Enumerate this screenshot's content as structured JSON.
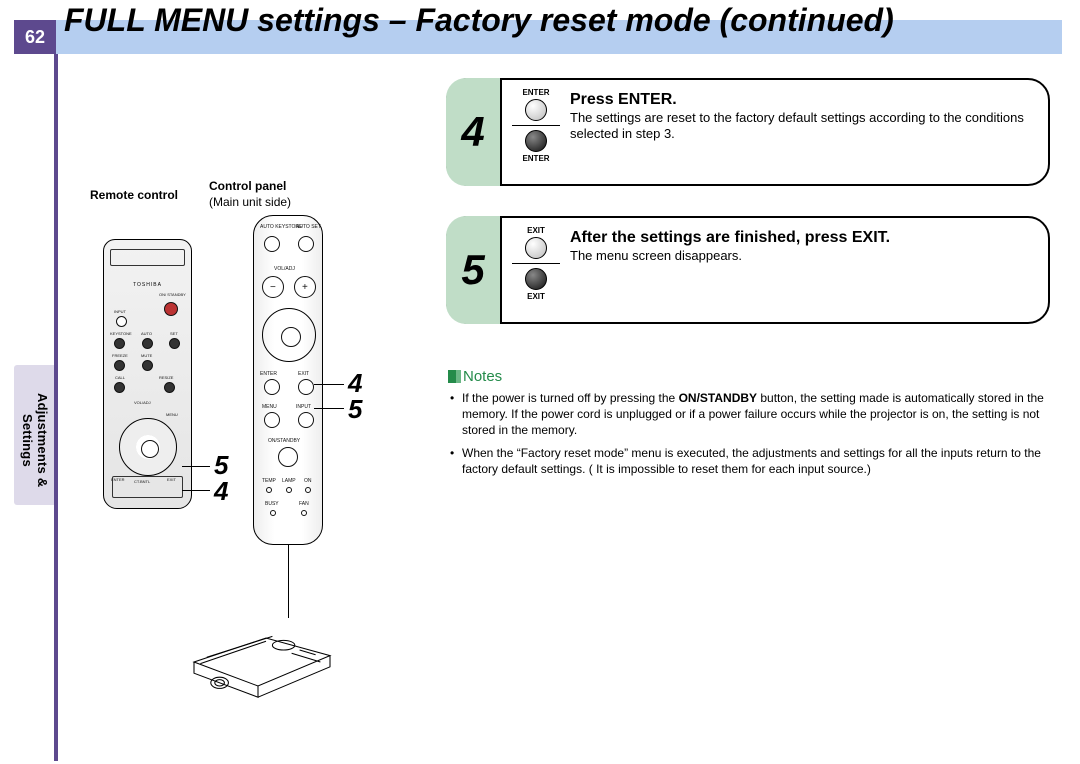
{
  "page_number": "62",
  "title": "FULL MENU settings – Factory reset mode (continued)",
  "side_tab": "Adjustments &\nSettings",
  "left": {
    "remote_label": "Remote control",
    "panel_label": "Control panel",
    "panel_sub": "(Main unit side)",
    "remote_brand": "TOSHIBA",
    "remote_buttons": {
      "on_standby": "ON/\nSTANDBY",
      "input": "INPUT",
      "keystone": "KEYSTONE",
      "auto": "AUTO",
      "set": "SET",
      "freeze": "FREEZE",
      "mute": "MUTE",
      "call": "CALL",
      "resize": "RESIZE",
      "vol_adj": "VOL/ADJ",
      "menu": "MENU",
      "enter": "ENTER",
      "exit": "EXIT",
      "ct_bntl": "CT.BNTL"
    },
    "panel_buttons": {
      "auto_keystone": "AUTO\nKEYSTONE",
      "auto_set": "AUTO\nSET",
      "vol_adj": "VOL/ADJ",
      "minus": "−",
      "plus": "+",
      "enter": "ENTER",
      "exit": "EXIT",
      "menu": "MENU",
      "input": "INPUT",
      "on_standby": "ON/STANDBY",
      "temp": "TEMP",
      "lamp": "LAMP",
      "on": "ON",
      "busy": "BUSY",
      "fan": "FAN"
    },
    "callout_remote_top": "5",
    "callout_remote_bottom": "4",
    "callout_panel_top": "4",
    "callout_panel_bottom": "5"
  },
  "steps": [
    {
      "num": "4",
      "btn_top": "ENTER",
      "btn_bottom": "ENTER",
      "heading": "Press ENTER.",
      "body": "The settings are reset to the factory default settings according to the conditions selected in step 3."
    },
    {
      "num": "5",
      "btn_top": "EXIT",
      "btn_bottom": "EXIT",
      "heading": "After the settings are finished, press EXIT.",
      "body": "The menu screen disappears."
    }
  ],
  "notes": {
    "heading": "Notes",
    "items": [
      "If the power is turned off by pressing the <b>ON/STANDBY</b> button, the setting made is automatically stored in the memory. If the power cord is unplugged or if a power failure occurs while the projector is on, the setting is not stored in the memory.",
      "When the “Factory reset mode” menu is executed, the adjustments and settings for all the inputs return to the factory default settings. ( It is impossible to reset them for each input source.)"
    ]
  }
}
